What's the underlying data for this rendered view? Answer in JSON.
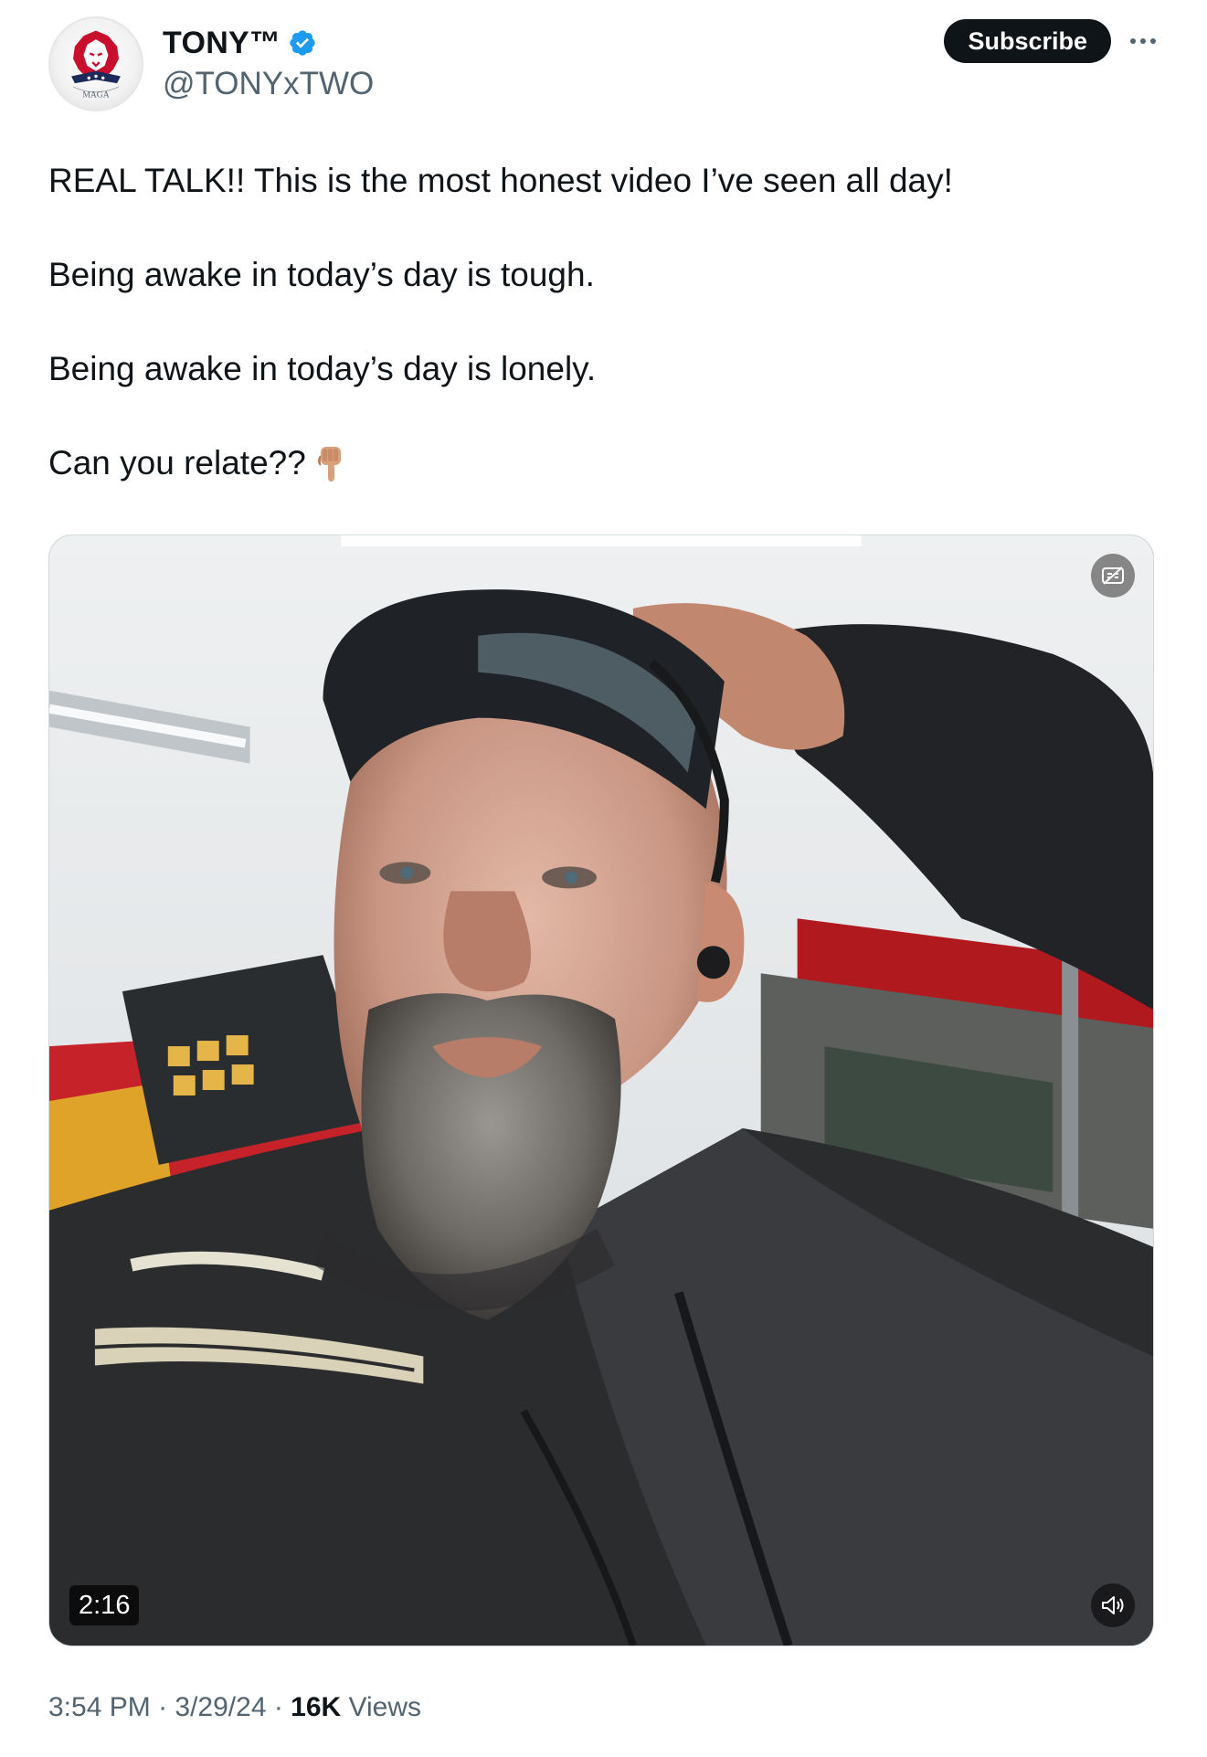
{
  "author": {
    "display_name": "TONY™",
    "handle": "@TONYxTWO",
    "avatar_label": "MAGA",
    "verified": true,
    "verified_color": "#1d9bf0"
  },
  "actions": {
    "subscribe_label": "Subscribe",
    "more_icon": "more-horizontal-icon"
  },
  "post": {
    "paragraphs": [
      "REAL TALK!! This is the most honest video I’ve seen all day!",
      "Being awake in today’s day is tough.",
      "Being awake in today’s day is lonely.",
      "Can you relate??"
    ],
    "trailing_emoji": "pointing-down-hand"
  },
  "media": {
    "type": "video",
    "duration": "2:16",
    "captions_icon": "captions-off-icon",
    "volume_icon": "speaker-icon"
  },
  "meta": {
    "time": "3:54 PM",
    "separator": " · ",
    "date": "3/29/24",
    "views_count": "16K",
    "views_label": " Views"
  },
  "colors": {
    "text": "#0f1419",
    "secondary_text": "#536471",
    "button_bg": "#0f1419",
    "brand_red": "#c8102e"
  }
}
